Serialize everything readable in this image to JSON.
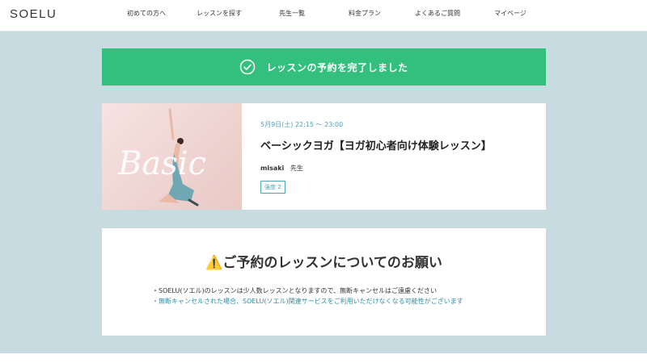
{
  "header": {
    "logo": "SOELU",
    "nav": [
      {
        "label": "初めての方へ"
      },
      {
        "label": "レッスンを探す"
      },
      {
        "label": "先生一覧"
      },
      {
        "label": "料金プラン"
      },
      {
        "label": "よくあるご質問"
      },
      {
        "label": "マイページ"
      }
    ]
  },
  "banner": {
    "icon": "check-circle-icon",
    "text": "レッスンの予約を完了しました",
    "color": "#33bf7d"
  },
  "lesson": {
    "image_text": "Basic",
    "datetime": "5月9日(土) 22:15 〜 23:00",
    "title": "ベーシックヨガ【ヨガ初心者向け体験レッスン】",
    "teacher_name": "misaki",
    "teacher_suffix": "先生",
    "difficulty": "強度 2"
  },
  "notice": {
    "title": "⚠️ご予約のレッスンについてのお願い",
    "line1": "・SOELU(ソエル)のレッスンは少人数レッスンとなりますので、無断キャンセルはご遠慮ください",
    "line2": "・無断キャンセルされた場合、SOELU(ソエル)関連サービスをご利用いただけなくなる可能性がございます"
  }
}
